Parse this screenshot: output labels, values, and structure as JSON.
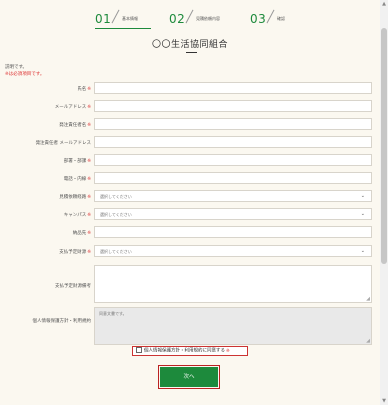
{
  "steps": [
    {
      "num": "01",
      "label": "基本情報"
    },
    {
      "num": "02",
      "label": "見積依頼内容"
    },
    {
      "num": "03",
      "label": "確認"
    }
  ],
  "title": "〇〇生活協同組合",
  "description": "説明です。",
  "required_note": "※は必須項目です。",
  "required_mark": "※",
  "form": {
    "name_label": "氏名",
    "email_label": "メールアドレス",
    "issuer_label": "発注責任者名",
    "issuer_email_label": "発注責任者 メールアドレス",
    "dept_label": "部署・部課",
    "phone_label": "電話・内線",
    "quote_method_label": "見積依頼経路",
    "quote_method_value": "選択してください",
    "campus_label": "キャンパス",
    "campus_value": "選択してください",
    "delivery_label": "納品先",
    "payment_label": "支払予定財源",
    "payment_value": "選択してください",
    "payment_note_label": "支払予定財源備考",
    "privacy_label": "個人情報保護方針・利用規約",
    "privacy_text": "同意文書です。"
  },
  "consent_label": "個人情報保護方針・利用規約に同意する",
  "next_label": "次へ",
  "colors": {
    "accent": "#1d8a3c",
    "required": "#dd3333",
    "background": "#fbf8f0"
  }
}
